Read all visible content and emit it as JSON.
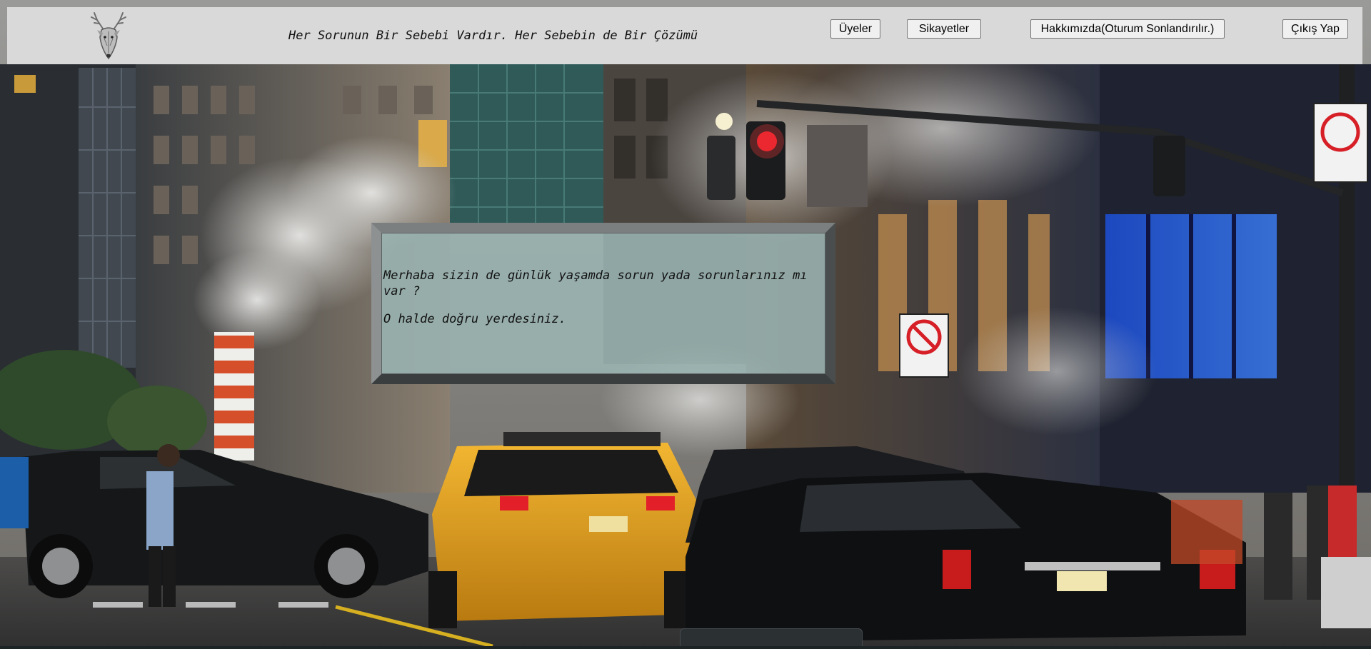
{
  "header": {
    "tagline": "Her Sorunun Bir Sebebi Vardır. Her Sebebin de Bir Çözümü",
    "logo_icon": "deer-head-icon",
    "nav": {
      "members_label": "Üyeler",
      "complaints_label": "Sikayetler",
      "about_label": "Hakkımızda(Oturum Sonlandırılır.)",
      "logout_label": "Çıkış Yap"
    }
  },
  "message": {
    "line1": "Merhaba sizin de günlük yaşamda sorun yada sorunlarınız mı var ?",
    "line2": "O halde doğru yerdesiniz."
  },
  "background": {
    "scene_icon": "city-street-photo",
    "colors": {
      "header_bg": "#d9d9d9",
      "taxi_yellow": "#e8a21a",
      "traffic_red": "#e3202a"
    }
  }
}
